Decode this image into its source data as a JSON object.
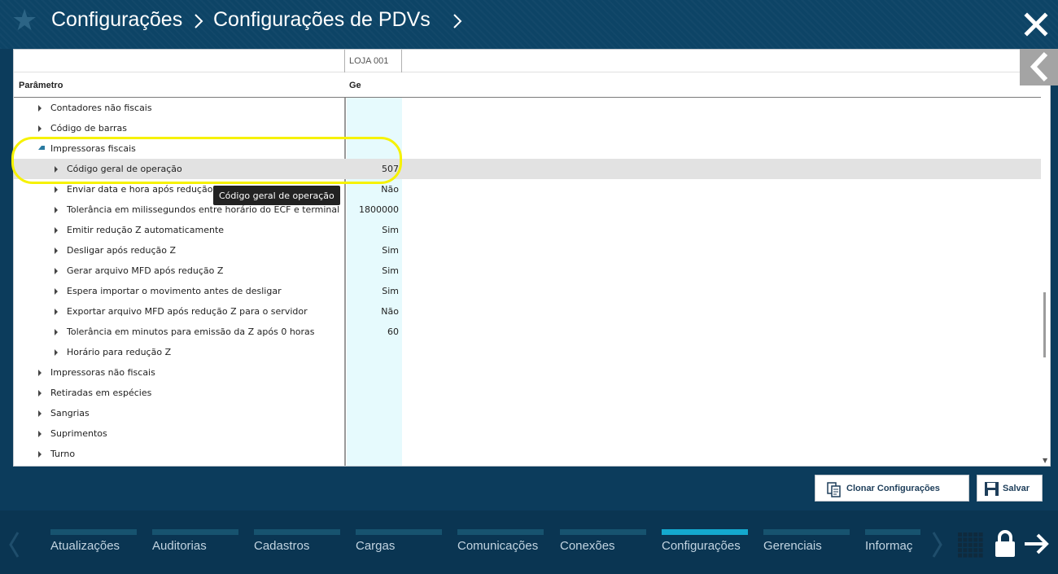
{
  "header": {
    "breadcrumb": [
      "Configurações",
      "Configurações de PDVs"
    ],
    "star_icon": "star-icon",
    "close_icon": "close-icon"
  },
  "grid": {
    "store_column": "LOJA 001",
    "param_header": "Parâmetro",
    "value_header": "Ge",
    "rows": [
      {
        "label": "Contadores não fiscais",
        "value": "",
        "level": 1,
        "expanded": false
      },
      {
        "label": "Código de barras",
        "value": "",
        "level": 1,
        "expanded": false
      },
      {
        "label": "Impressoras fiscais",
        "value": "",
        "level": 1,
        "expanded": true
      },
      {
        "label": "Código geral de operação",
        "value": "507",
        "level": 2,
        "selected": true
      },
      {
        "label": "Enviar data e hora após redução Z",
        "value": "Não",
        "level": 2
      },
      {
        "label": "Tolerância em milissegundos entre horário do ECF e terminal",
        "value": "1800000",
        "level": 2
      },
      {
        "label": "Emitir redução Z automaticamente",
        "value": "Sim",
        "level": 2
      },
      {
        "label": "Desligar após redução Z",
        "value": "Sim",
        "level": 2
      },
      {
        "label": "Gerar arquivo MFD após redução Z",
        "value": "Sim",
        "level": 2
      },
      {
        "label": "Espera importar o movimento antes de desligar",
        "value": "Sim",
        "level": 2
      },
      {
        "label": "Exportar arquivo MFD após redução Z para o servidor",
        "value": "Não",
        "level": 2
      },
      {
        "label": "Tolerância em minutos para emissão da Z após 0 horas",
        "value": "60",
        "level": 2
      },
      {
        "label": "Horário para redução Z",
        "value": "",
        "level": 2
      },
      {
        "label": "Impressoras não fiscais",
        "value": "",
        "level": 1,
        "expanded": false
      },
      {
        "label": "Retiradas em espécies",
        "value": "",
        "level": 1,
        "expanded": false
      },
      {
        "label": "Sangrias",
        "value": "",
        "level": 1,
        "expanded": false
      },
      {
        "label": "Suprimentos",
        "value": "",
        "level": 1,
        "expanded": false
      },
      {
        "label": "Turno",
        "value": "",
        "level": 1,
        "expanded": false
      }
    ],
    "tooltip": "Código geral de operação"
  },
  "actions": {
    "clone_label": "Clonar Configurações",
    "save_label": "Salvar"
  },
  "bottom_nav": {
    "items": [
      "Atualizações",
      "Auditorias",
      "Cadastros",
      "Cargas",
      "Comunicações",
      "Conexões",
      "Configurações",
      "Gerenciais",
      "Informaç"
    ],
    "active": "Configurações"
  },
  "colors": {
    "header_bg": "#0d4466",
    "accent": "#14a9cf",
    "highlight": "#f6f200",
    "value_col": "#e6fafd"
  }
}
